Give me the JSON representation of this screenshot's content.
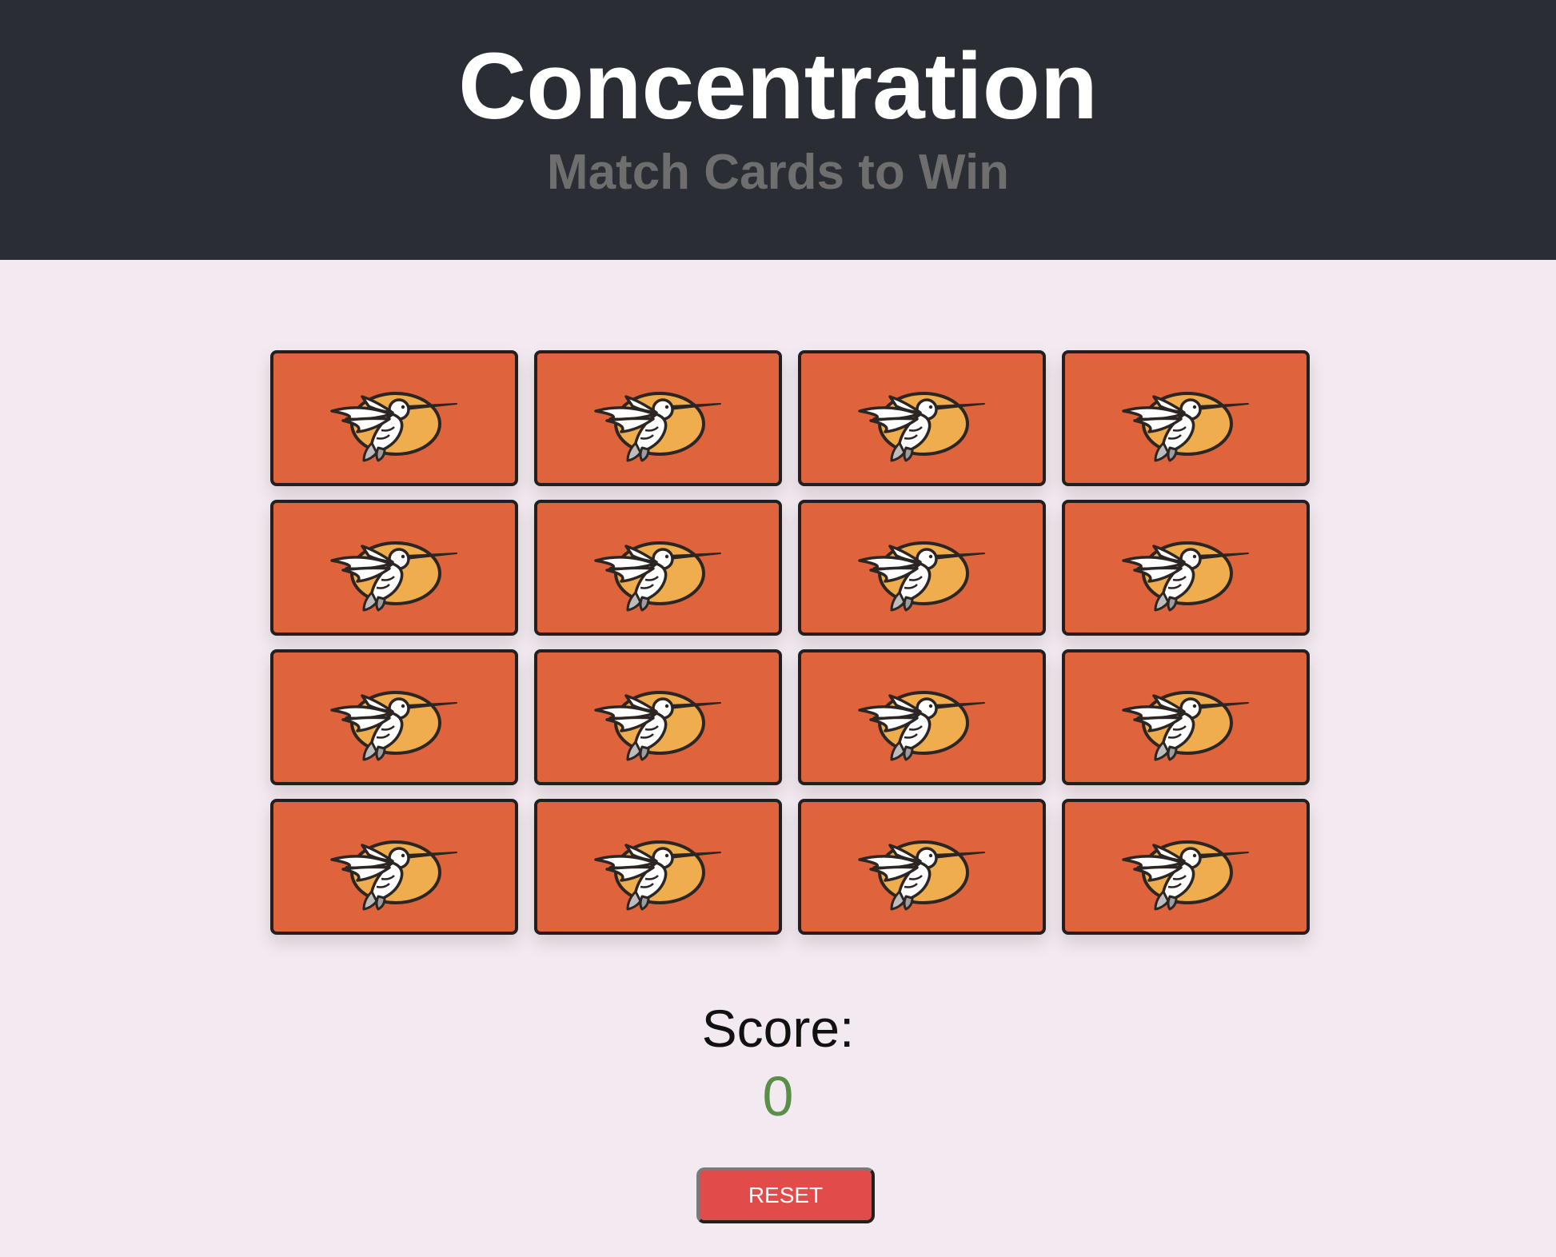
{
  "header": {
    "title": "Concentration",
    "subtitle": "Match Cards to Win"
  },
  "board": {
    "rows": 4,
    "columns": 4,
    "cards": [
      {
        "state": "face-down",
        "icon": "hummingbird-icon"
      },
      {
        "state": "face-down",
        "icon": "hummingbird-icon"
      },
      {
        "state": "face-down",
        "icon": "hummingbird-icon"
      },
      {
        "state": "face-down",
        "icon": "hummingbird-icon"
      },
      {
        "state": "face-down",
        "icon": "hummingbird-icon"
      },
      {
        "state": "face-down",
        "icon": "hummingbird-icon"
      },
      {
        "state": "face-down",
        "icon": "hummingbird-icon"
      },
      {
        "state": "face-down",
        "icon": "hummingbird-icon"
      },
      {
        "state": "face-down",
        "icon": "hummingbird-icon"
      },
      {
        "state": "face-down",
        "icon": "hummingbird-icon"
      },
      {
        "state": "face-down",
        "icon": "hummingbird-icon"
      },
      {
        "state": "face-down",
        "icon": "hummingbird-icon"
      },
      {
        "state": "face-down",
        "icon": "hummingbird-icon"
      },
      {
        "state": "face-down",
        "icon": "hummingbird-icon"
      },
      {
        "state": "face-down",
        "icon": "hummingbird-icon"
      },
      {
        "state": "face-down",
        "icon": "hummingbird-icon"
      }
    ]
  },
  "score": {
    "label": "Score:",
    "value": "0"
  },
  "controls": {
    "reset_label": "RESET"
  },
  "colors": {
    "header_bg": "#2a2d34",
    "page_bg": "#f3e9f0",
    "card_back": "#df633b",
    "card_circle": "#f0ad4e",
    "score_value": "#5a8f4a",
    "reset_button": "#e14c4b"
  }
}
